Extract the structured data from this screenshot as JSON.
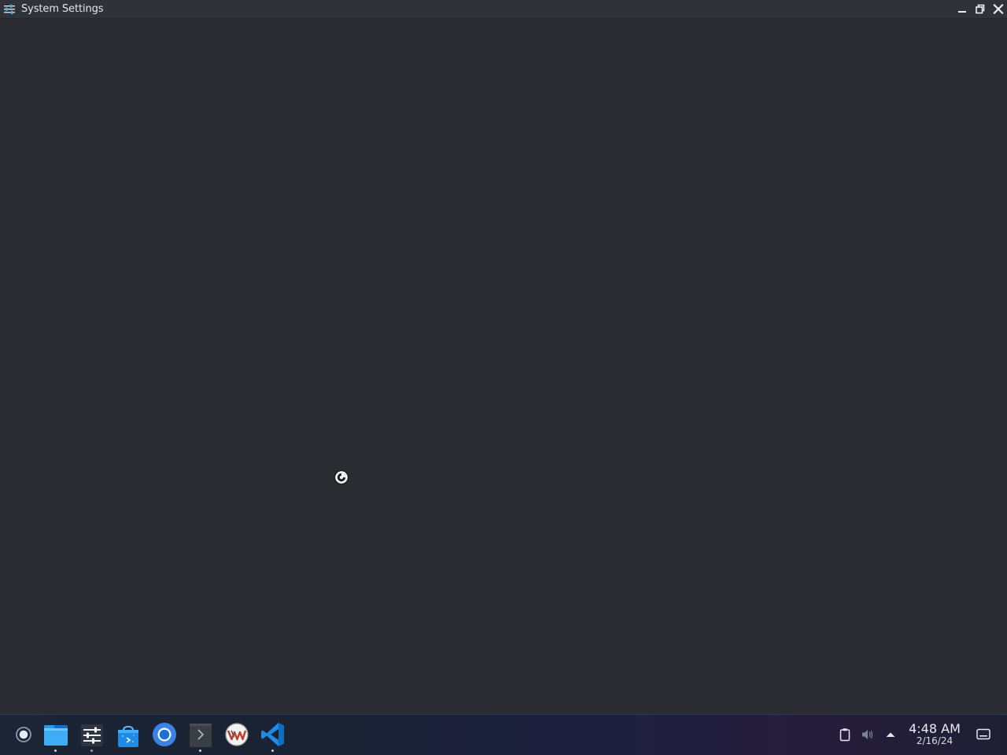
{
  "window": {
    "title": "System Settings",
    "app_icon": "sliders-icon",
    "controls": [
      "minimize-icon",
      "maximize-icon",
      "close-icon"
    ],
    "state": "loading",
    "cursor": "busy-cursor-icon"
  },
  "taskbar": {
    "launcher": {
      "icon": "application-launcher-icon"
    },
    "pinned_apps": [
      {
        "name": "files",
        "icon": "folder-icon",
        "running": true
      },
      {
        "name": "system-settings",
        "icon": "sliders-icon",
        "running": true,
        "active": true
      },
      {
        "name": "store",
        "icon": "store-bag-icon",
        "running": false
      },
      {
        "name": "chromium",
        "icon": "chromium-icon",
        "running": false
      },
      {
        "name": "terminal",
        "icon": "terminal-icon",
        "running": true
      },
      {
        "name": "virtual-machine-manager",
        "icon": "vmm-icon",
        "running": false
      },
      {
        "name": "vscode",
        "icon": "vscode-icon",
        "running": true
      }
    ],
    "tray": {
      "icons": [
        "clipboard-icon",
        "volume-icon",
        "expand-tray-icon"
      ],
      "clock": {
        "time": "4:48 AM",
        "date": "2/16/24"
      },
      "show_desktop_icon": "show-desktop-icon"
    }
  },
  "colors": {
    "window_background": "#2a2c31",
    "titlebar_background": "#2f3238",
    "taskbar_gradient_start": "#1b2535",
    "taskbar_gradient_end": "#261d3b",
    "accent_blue": "#1e8ce6"
  }
}
